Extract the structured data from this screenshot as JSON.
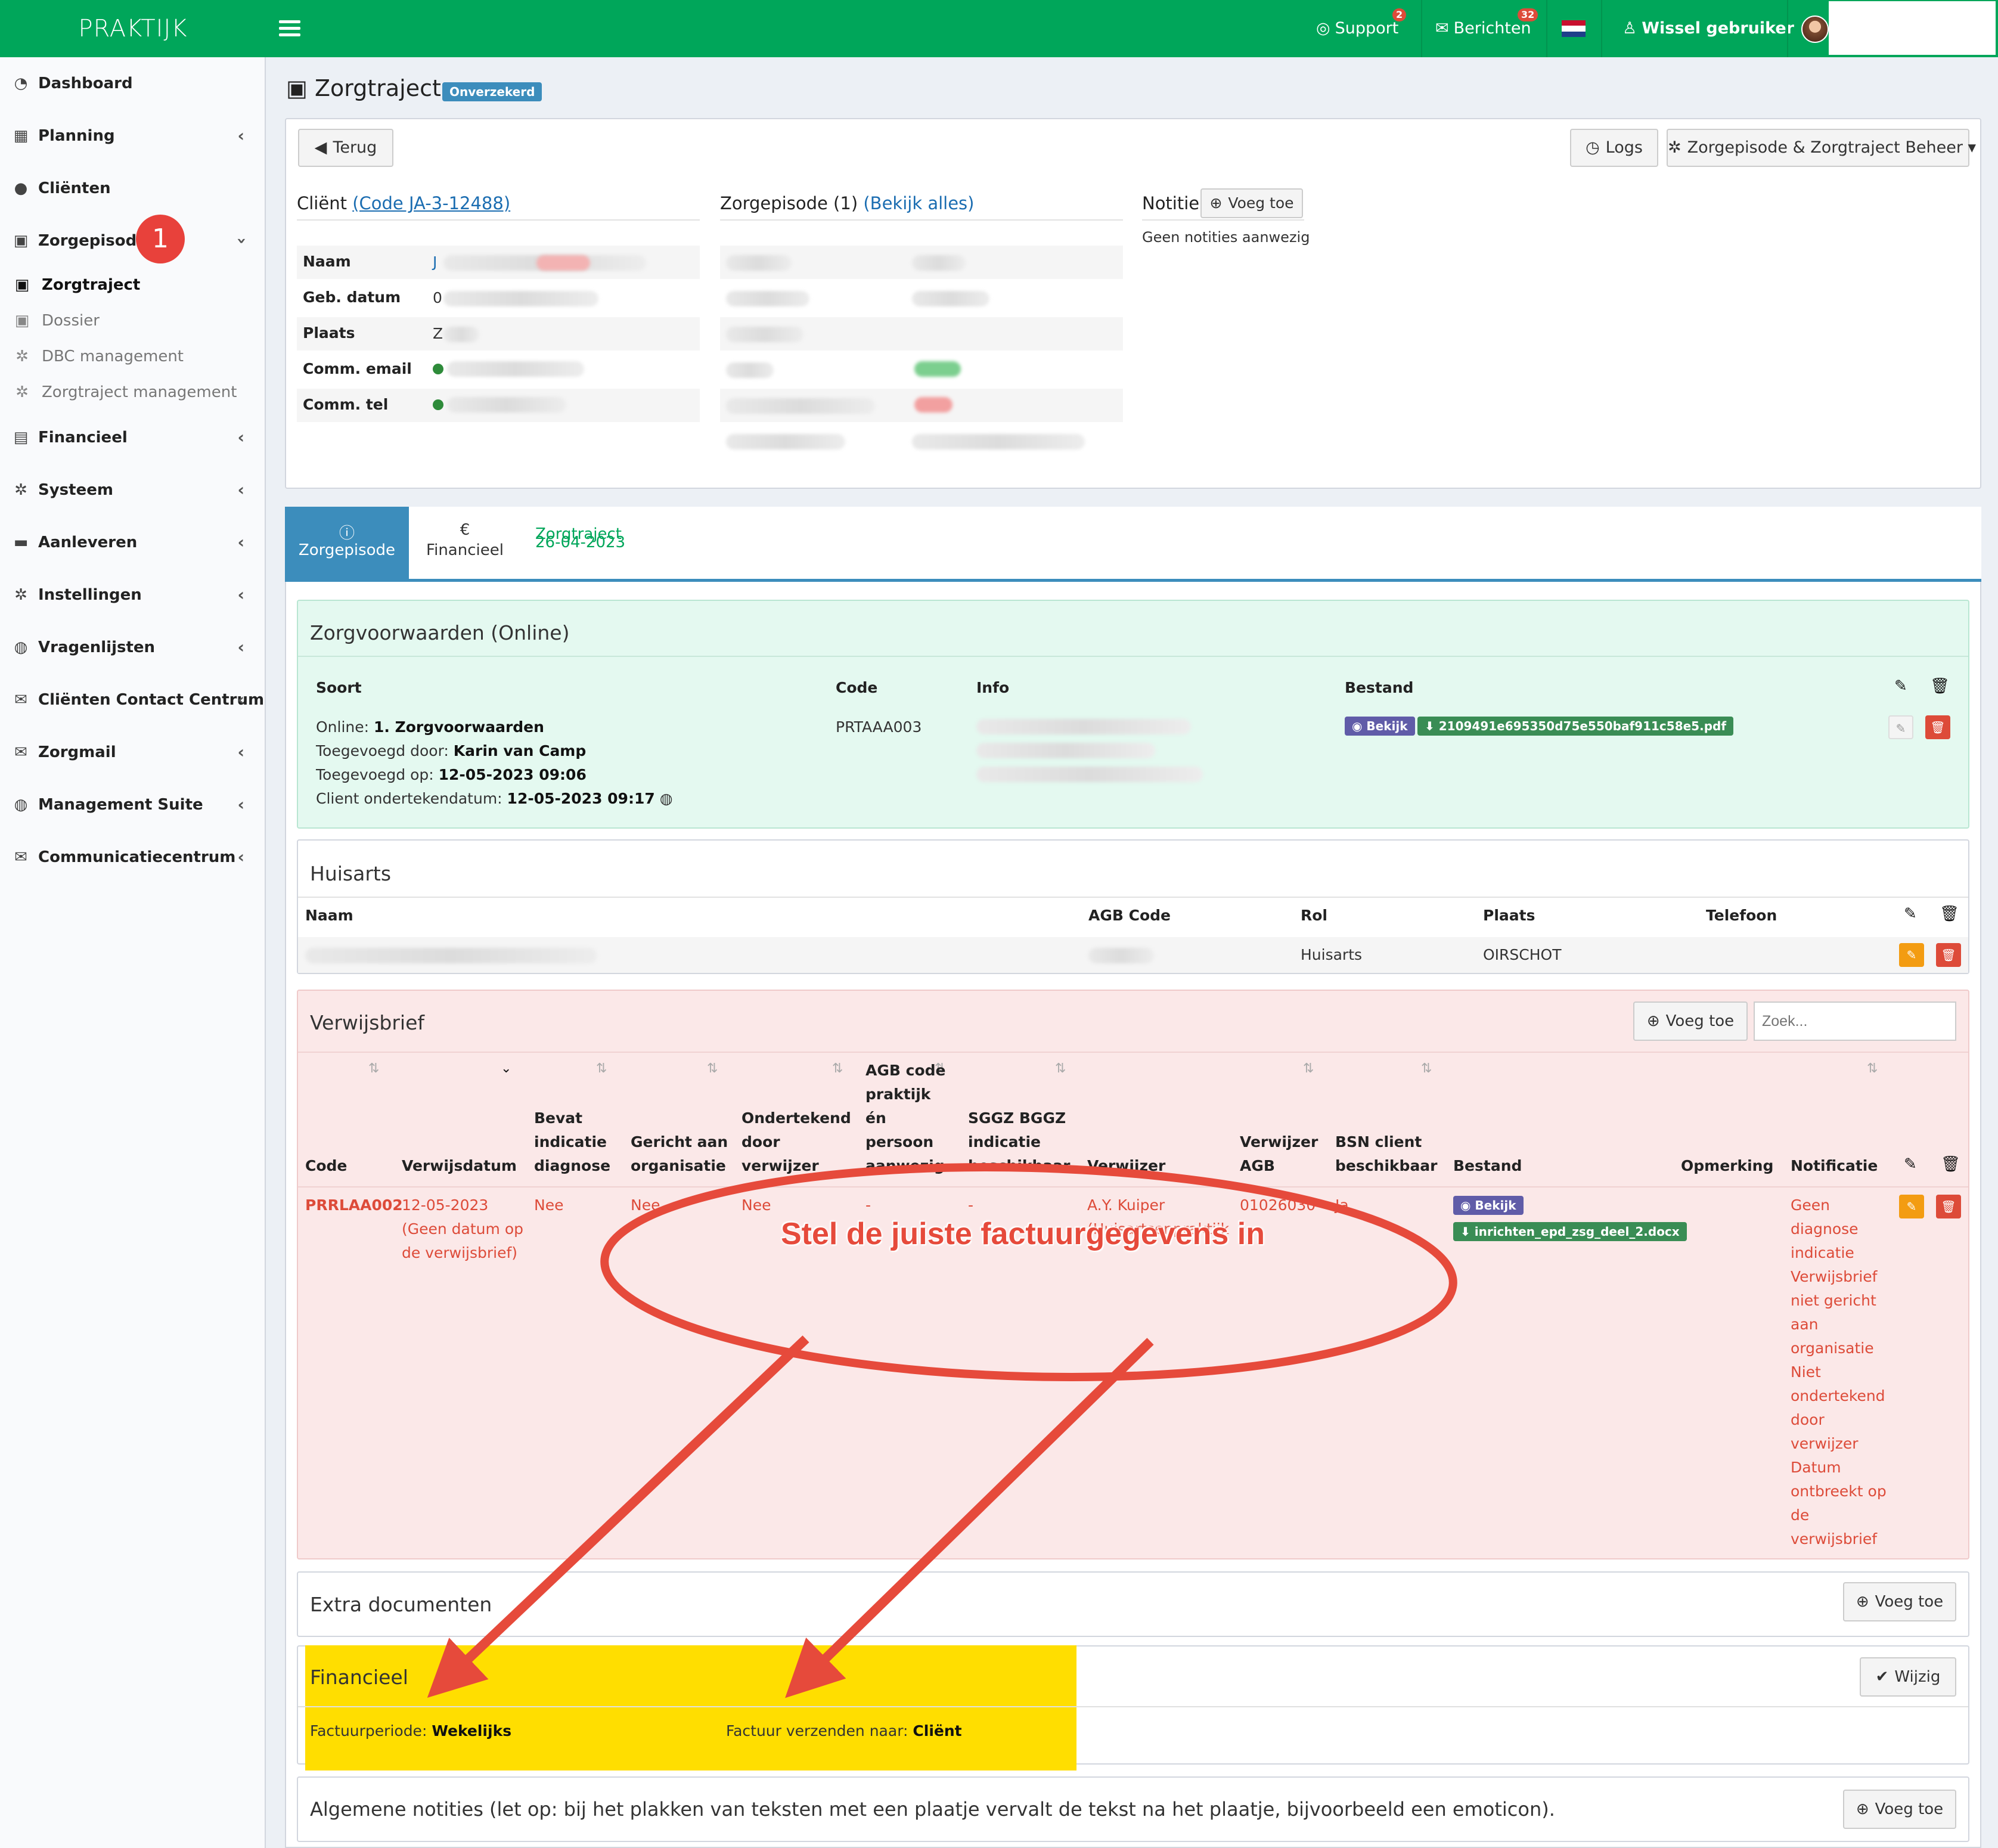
{
  "header": {
    "logo": "PRAKTIJK",
    "support": "Support",
    "support_badge": "2",
    "messages": "Berichten",
    "messages_badge": "32",
    "switch_user": "Wissel gebruiker"
  },
  "sidebar": {
    "items": [
      {
        "label": "Dashboard",
        "icon": "dashboard-icon"
      },
      {
        "label": "Planning",
        "icon": "calendar-icon"
      },
      {
        "label": "Cliënten",
        "icon": "user-icon"
      },
      {
        "label": "Zorgepisode",
        "icon": "briefcase-medical-icon"
      },
      {
        "label": "Financieel",
        "icon": "book-icon"
      },
      {
        "label": "Systeem",
        "icon": "cogs-icon"
      },
      {
        "label": "Aanleveren",
        "icon": "truck-icon"
      },
      {
        "label": "Instellingen",
        "icon": "gear-icon"
      },
      {
        "label": "Vragenlijsten",
        "icon": "globe-icon"
      },
      {
        "label": "Cliënten Contact Centrum",
        "icon": "envelope-icon"
      },
      {
        "label": "Zorgmail",
        "icon": "envelope-icon"
      },
      {
        "label": "Management Suite",
        "icon": "globe-icon"
      },
      {
        "label": "Communicatiecentrum",
        "icon": "envelope-icon"
      }
    ],
    "subitems": [
      {
        "label": "Zorgtraject"
      },
      {
        "label": "Dossier"
      },
      {
        "label": "DBC management"
      },
      {
        "label": "Zorgtraject management"
      }
    ],
    "step_badge": "1"
  },
  "page": {
    "title": "Zorgtraject",
    "status_label": "Onverzekerd",
    "back_button": "Terug",
    "logs_button": "Logs",
    "manage_button": "Zorgepisode & Zorgtraject Beheer"
  },
  "client": {
    "heading": "Cliënt",
    "code_link": "(Code JA-3-12488)",
    "fields": [
      "Naam",
      "Geb. datum",
      "Plaats",
      "Comm. email",
      "Comm. tel"
    ],
    "naam_initial": "J",
    "geb_initial": "0",
    "plaats_initial": "Z"
  },
  "episode": {
    "heading": "Zorgepisode (1)",
    "link": "(Bekijk alles)"
  },
  "notes": {
    "heading": "Notitie",
    "add_button": "Voeg toe",
    "empty": "Geen notities aanwezig"
  },
  "tabs": [
    {
      "label": "Zorgepisode",
      "icon": "info-icon"
    },
    {
      "label": "Financieel",
      "icon": "euro-icon"
    },
    {
      "label": "Zorgtraject",
      "sub": "26-04-2023"
    }
  ],
  "zorgvoorwaarden": {
    "title": "Zorgvoorwaarden (Online)",
    "headers": [
      "Soort",
      "Code",
      "Info",
      "Bestand"
    ],
    "lines": [
      {
        "k": "Online: ",
        "v": "1. Zorgvoorwaarden"
      },
      {
        "k": "Toegevoegd door: ",
        "v": "Karin van Camp"
      },
      {
        "k": "Toegevoegd op: ",
        "v": "12-05-2023 09:06"
      },
      {
        "k": "Client ondertekendatum: ",
        "v": "12-05-2023 09:17"
      }
    ],
    "code": "PRTAAA003",
    "view": "Bekijk",
    "file": "2109491e695350d75e550baf911c58e5.pdf"
  },
  "huisarts": {
    "title": "Huisarts",
    "headers": [
      "Naam",
      "AGB Code",
      "Rol",
      "Plaats",
      "Telefoon"
    ],
    "row": {
      "rol": "Huisarts",
      "plaats": "OIRSCHOT"
    }
  },
  "verwijsbrief": {
    "title": "Verwijsbrief",
    "add_button": "Voeg toe",
    "search_placeholder": "Zoek...",
    "headers": {
      "code": "Code",
      "datum": "Verwijsdatum",
      "bevat": [
        "Bevat",
        "indicatie",
        "diagnose"
      ],
      "gericht": [
        "Gericht aan",
        "organisatie"
      ],
      "ondertekend": [
        "Ondertekend",
        "door",
        "verwijzer"
      ],
      "agb": [
        "AGB code",
        "praktijk",
        "én",
        "persoon",
        "aanwezig"
      ],
      "sggz": [
        "SGGZ BGGZ",
        "indicatie",
        "beschikbaar"
      ],
      "verwijzer": "Verwijzer",
      "verwijzer_agb": [
        "Verwijzer",
        "AGB"
      ],
      "bsn": [
        "BSN client",
        "beschikbaar"
      ],
      "bestand": "Bestand",
      "opmerking": "Opmerking",
      "notificatie": "Notificatie"
    },
    "row": {
      "code": "PRRLAA002",
      "datum": [
        "12-05-2023",
        "(Geen datum op",
        "de verwijsbrief)"
      ],
      "bevat": "Nee",
      "gericht": "Nee",
      "ondertekend": "Nee",
      "agb": "-",
      "sggz": "-",
      "verwijzer": "A.Y. Kuiper",
      "verwijzer_sub": "(Huisartsenpraktijk",
      "verwijzer_agb": "01026030",
      "bsn": "Ja",
      "view": "Bekijk",
      "file": "inrichten_epd_zsg_deel_2.docx",
      "notificatie": [
        "Geen",
        "diagnose",
        "indicatie",
        "Verwijsbrief",
        "niet gericht",
        "aan",
        "organisatie",
        "Niet",
        "ondertekend",
        "door",
        "verwijzer",
        "Datum",
        "ontbreekt op",
        "de",
        "verwijsbrief"
      ]
    }
  },
  "extra_docs": {
    "title": "Extra documenten",
    "add_button": "Voeg toe"
  },
  "financieel": {
    "title": "Financieel",
    "edit_button": "Wijzig",
    "period_label": "Factuurperiode: ",
    "period_value": "Wekelijks",
    "send_label": "Factuur verzenden naar: ",
    "send_value": "Cliënt"
  },
  "algemene": {
    "title": "Algemene notities (let op: bij het plakken van teksten met een plaatje vervalt de tekst na het plaatje, bijvoorbeeld een emoticon).",
    "add_button": "Voeg toe"
  },
  "annotation": {
    "callout": "Stel de juiste factuurgegevens in",
    "color": "#e64a3b"
  },
  "colors": {
    "header_green": "#00a65a",
    "primary_blue": "#3c8dbc",
    "danger_red": "#dd4b39",
    "highlight_yellow": "#ffde00"
  }
}
